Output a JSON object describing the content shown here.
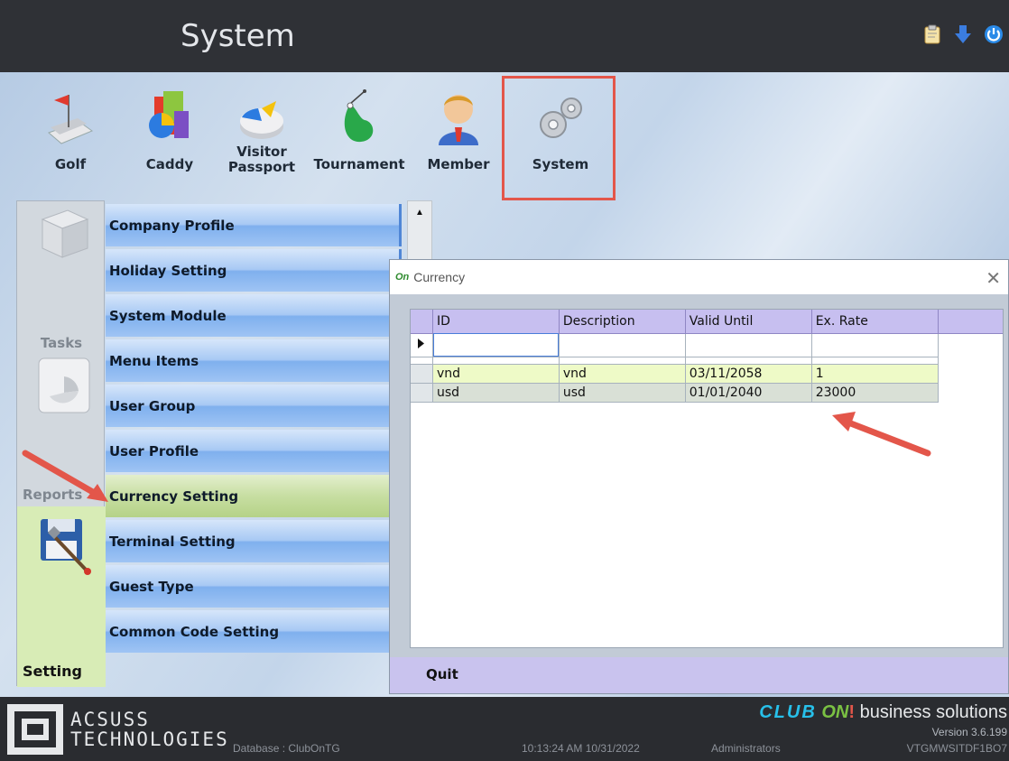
{
  "app": {
    "title": "System"
  },
  "modules": [
    {
      "label": "Golf"
    },
    {
      "label": "Caddy"
    },
    {
      "label": "Visitor\nPassport"
    },
    {
      "label": "Tournament"
    },
    {
      "label": "Member"
    },
    {
      "label": "System"
    }
  ],
  "sidebar": {
    "tasks_label": "Tasks",
    "reports_label": "Reports",
    "setting_label": "Setting"
  },
  "menu": {
    "items": [
      {
        "label": "Company Profile"
      },
      {
        "label": "Holiday Setting"
      },
      {
        "label": "System Module"
      },
      {
        "label": "Menu Items"
      },
      {
        "label": "User Group"
      },
      {
        "label": "User Profile"
      },
      {
        "label": "Currency Setting"
      },
      {
        "label": "Terminal Setting"
      },
      {
        "label": "Guest Type"
      },
      {
        "label": "Common Code Setting"
      }
    ],
    "active": "Currency Setting"
  },
  "dialog": {
    "logo": "On",
    "title": "Currency",
    "columns": [
      "ID",
      "Description",
      "Valid Until",
      "Ex. Rate"
    ],
    "rows": [
      {
        "id": "vnd",
        "description": "vnd",
        "valid_until": "03/11/2058",
        "ex_rate": "1"
      },
      {
        "id": "usd",
        "description": "usd",
        "valid_until": "01/01/2040",
        "ex_rate": "23000"
      }
    ],
    "quit_label": "Quit"
  },
  "footer": {
    "logo_line1": "ACSUSS",
    "logo_line2": "TECHNOLOGIES",
    "database": "Database : ClubOnTG",
    "datetime": "10:13:24 AM 10/31/2022",
    "user_group": "Administrators",
    "brand_club": "CLUB",
    "brand_on": "ON",
    "brand_bang": "!",
    "brand_rest": " business solutions",
    "version": "Version 3.6.199",
    "machine": "VTGMWSITDF1BO7"
  },
  "colors": {
    "highlight": "#e3564a",
    "menu_blue": "#7fb0ee",
    "menu_active": "#c7dea2",
    "grid_header": "#c7bff0"
  }
}
